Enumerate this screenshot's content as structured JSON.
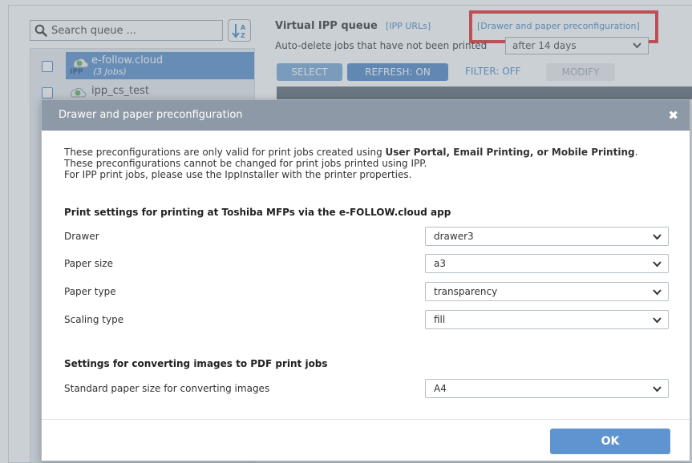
{
  "search": {
    "placeholder": "Search queue ..."
  },
  "queues": [
    {
      "name": "e-follow.cloud",
      "count": "(3 Jobs)",
      "badge": "IPP"
    },
    {
      "name": "ipp_cs_test"
    }
  ],
  "main": {
    "title": "Virtual IPP queue",
    "ipp_urls_link": "[IPP URLs]",
    "drawer_link": "[Drawer and paper preconfiguration]",
    "auto_delete_label": "Auto-delete jobs that have not been printed",
    "auto_delete_value": "after 14 days",
    "buttons": {
      "select": "SELECT",
      "refresh": "REFRESH: ON",
      "filter": "FILTER: OFF",
      "modify": "MODIFY"
    }
  },
  "modal": {
    "title": "Drawer and paper preconfiguration",
    "close": "✖",
    "intro_line1_prefix": "These preconfigurations are only valid for print jobs created using ",
    "intro_line1_bold": "User Portal, Email Printing, or Mobile Printing",
    "intro_line1_suffix": ".",
    "intro_line2": "These preconfigurations cannot be changed for print jobs printed using IPP.",
    "intro_line3": "For IPP print jobs, please use the IppInstaller with the printer properties.",
    "section1_title": "Print settings for printing at Toshiba MFPs via the e-FOLLOW.cloud app",
    "rows": [
      {
        "label": "Drawer",
        "value": "drawer3"
      },
      {
        "label": "Paper size",
        "value": "a3"
      },
      {
        "label": "Paper type",
        "value": "transparency"
      },
      {
        "label": "Scaling type",
        "value": "fill"
      }
    ],
    "section2_title": "Settings for converting images to PDF print jobs",
    "convert_row": {
      "label": "Standard paper size for converting images",
      "value": "A4"
    },
    "ok_label": "OK"
  },
  "colors": {
    "accent": "#3c7cc1",
    "highlight_box": "#e8141c",
    "modal_header": "#8d99a6"
  }
}
